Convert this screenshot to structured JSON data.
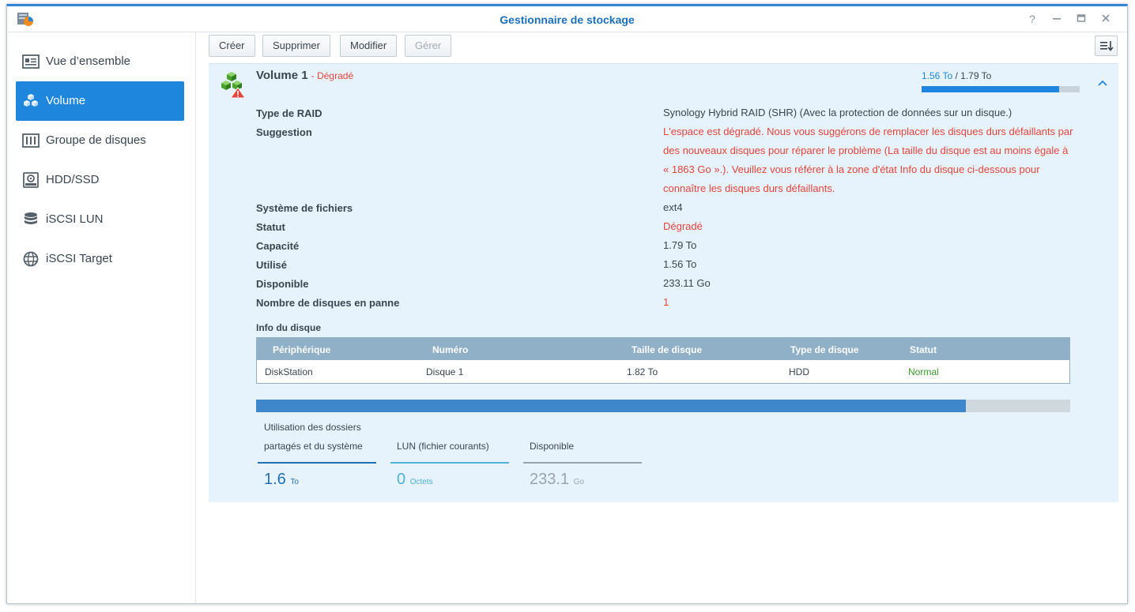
{
  "window": {
    "title": "Gestionnaire de stockage"
  },
  "sidebar": {
    "items": [
      {
        "label": "Vue d’ensemble",
        "icon": "overview-icon"
      },
      {
        "label": "Volume",
        "icon": "volume-cubes-icon"
      },
      {
        "label": "Groupe de disques",
        "icon": "disk-group-icon"
      },
      {
        "label": "HDD/SSD",
        "icon": "hdd-icon"
      },
      {
        "label": "iSCSI LUN",
        "icon": "database-icon"
      },
      {
        "label": "iSCSI Target",
        "icon": "globe-icon"
      }
    ],
    "active_index": 1
  },
  "toolbar": {
    "create_label": "Créer",
    "delete_label": "Supprimer",
    "modify_label": "Modifier",
    "manage_label": "Gérer"
  },
  "volume": {
    "name": "Volume 1",
    "status_inline": "- Dégradé",
    "usage_used": "1.56 To",
    "usage_sep": " / ",
    "usage_total": "1.79 To",
    "usage_fraction": 0.87,
    "properties": {
      "raid_label": "Type de RAID",
      "raid_value": "Synology Hybrid RAID (SHR) (Avec la protection de données sur un disque.)",
      "suggestion_label": "Suggestion",
      "suggestion_value": "L'espace est dégradé. Nous vous suggérons de remplacer les disques durs défaillants par des nouveaux disques pour réparer le problème (La taille du disque est au moins égale à « 1863 Go ».). Veuillez vous référer à la zone d'état Info du disque ci-dessous pour connaître les disques durs défaillants.",
      "fs_label": "Système de fichiers",
      "fs_value": "ext4",
      "status_label": "Statut",
      "status_value": "Dégradé",
      "capacity_label": "Capacité",
      "capacity_value": "1.79 To",
      "used_label": "Utilisé",
      "used_value": "1.56 To",
      "available_label": "Disponible",
      "available_value": "233.11 Go",
      "failed_label": "Nombre de disques en panne",
      "failed_value": "1"
    },
    "disk_info": {
      "title": "Info du disque",
      "columns": [
        "Périphérique",
        "Numéro",
        "Taille de disque",
        "Type de disque",
        "Statut"
      ],
      "rows": [
        [
          "DiskStation",
          "Disque 1",
          "1.82 To",
          "HDD",
          "Normal"
        ]
      ]
    },
    "storage_bar_fraction": 0.872,
    "legend": [
      {
        "label": "Utilisation des dossiers partagés et du système",
        "value": "1.6",
        "unit": "To",
        "color": "#1f6fb3"
      },
      {
        "label": "LUN (fichier courants)",
        "value": "0",
        "unit": "Octets",
        "color": "#4fb0d8"
      },
      {
        "label": "Disponible",
        "value": "233.1",
        "unit": "Go",
        "color": "#9aa4ad"
      }
    ]
  },
  "colors": {
    "accent": "#1e87dd",
    "error": "#e2453c",
    "ok": "#3a9a2a",
    "panel": "#e7f3fc",
    "table_header": "#8fb0c6"
  }
}
